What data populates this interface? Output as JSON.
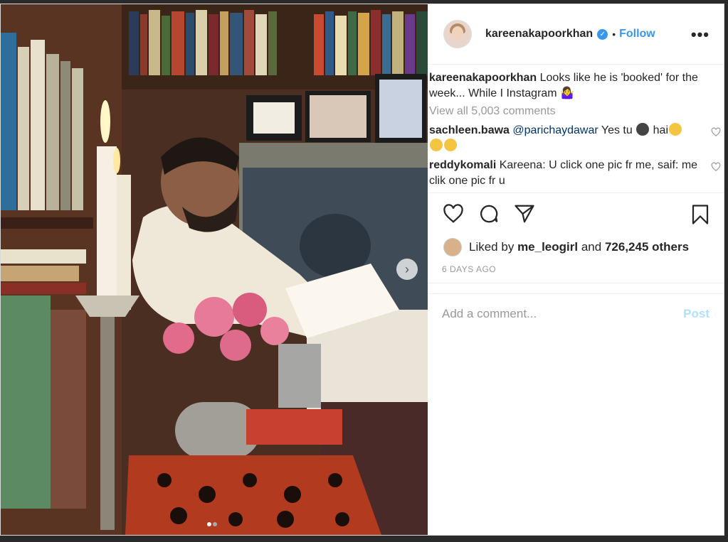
{
  "post": {
    "username": "kareenakapoorkhan",
    "follow_label": "Follow",
    "separator": "•",
    "more_label": "•••",
    "caption_user": "kareenakapoorkhan",
    "caption_text": " Looks like he is 'booked' for the week... While I Instagram 🤷‍♀️",
    "view_all": "View all 5,003 comments",
    "comments": [
      {
        "user": "sachleen.bawa",
        "mention": "@parichaydawar",
        "text": " Yes tu ",
        "text2": " hai"
      },
      {
        "user": "reddykomali",
        "text": " Kareena: U click one pic fr me, saif: me clik one pic fr u"
      }
    ],
    "liked_prefix": "Liked by ",
    "liked_user": "me_leogirl",
    "liked_and": " and ",
    "liked_others": "726,245 others",
    "time_ago": "6 DAYS AGO",
    "comment_placeholder": "Add a comment...",
    "post_button": "Post",
    "next_label": "›",
    "accent_color": "#3897f0"
  }
}
